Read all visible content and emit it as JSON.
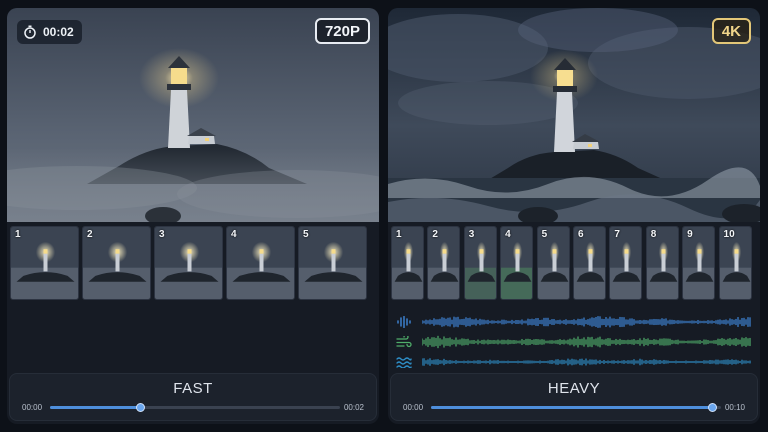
{
  "colors": {
    "accent_blue": "#4e8fdc",
    "accent_gold": "#e3c778",
    "panel_bg": "#161b24",
    "page_bg": "#0d1118"
  },
  "left_panel": {
    "timer_icon": "stopwatch-icon",
    "timer": "00:02",
    "resolution": "720P",
    "thumbnails": [
      "1",
      "2",
      "3",
      "4",
      "5"
    ],
    "mode": "FAST",
    "time_start": "00:00",
    "time_end": "00:02",
    "progress": 0.31
  },
  "right_panel": {
    "resolution": "4K",
    "thumbnails": [
      "1",
      "2",
      "3",
      "4",
      "5",
      "6",
      "7",
      "8",
      "9",
      "10"
    ],
    "audio_tracks": [
      {
        "icon": "audio-waveform-icon",
        "color": "#3f86d8"
      },
      {
        "icon": "wind-icon",
        "color": "#4fae6a"
      },
      {
        "icon": "waves-icon",
        "color": "#2e8fc8"
      }
    ],
    "mode": "HEAVY",
    "time_start": "00:00",
    "time_end": "00:10",
    "progress": 0.97
  }
}
